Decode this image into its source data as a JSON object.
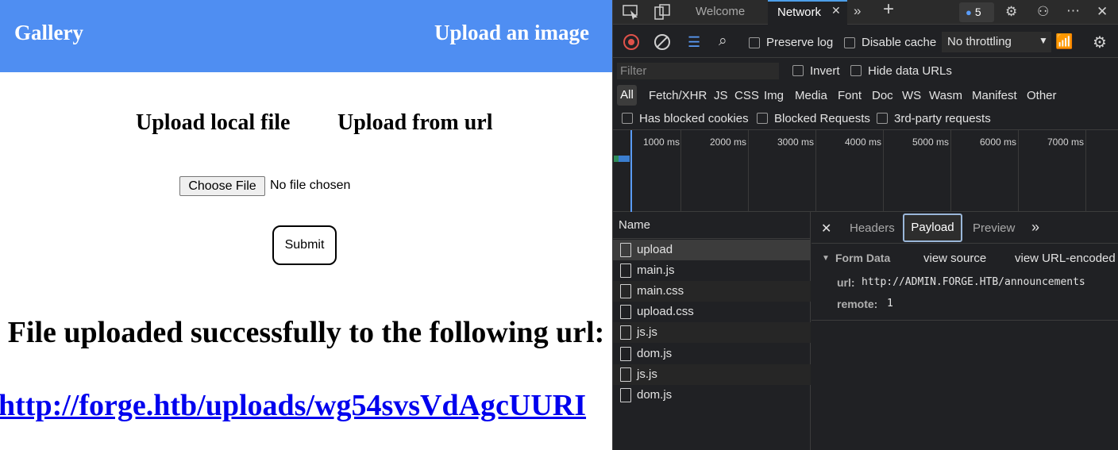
{
  "navbar": {
    "brand": "Gallery",
    "upload_link": "Upload an image"
  },
  "upload_tabs": {
    "local": "Upload local file",
    "url": "Upload from url"
  },
  "file_input": {
    "button_label": "Choose File",
    "status": "No file chosen"
  },
  "submit_label": "Submit",
  "result": {
    "message": "File uploaded successfully to the following url:",
    "url": "http://forge.htb/uploads/wg54svsVdAgcUURI"
  },
  "devtools": {
    "tabs": {
      "welcome": "Welcome",
      "network": "Network",
      "issues_count": "5"
    },
    "toolbar": {
      "preserve_log": "Preserve log",
      "disable_cache": "Disable cache",
      "throttling": "No throttling"
    },
    "filter": {
      "placeholder": "Filter",
      "invert": "Invert",
      "hide_data_urls": "Hide data URLs"
    },
    "types": [
      "All",
      "Fetch/XHR",
      "JS",
      "CSS",
      "Img",
      "Media",
      "Font",
      "Doc",
      "WS",
      "Wasm",
      "Manifest",
      "Other"
    ],
    "options": {
      "blocked_cookies": "Has blocked cookies",
      "blocked_requests": "Blocked Requests",
      "third_party": "3rd-party requests"
    },
    "timeline_ticks": [
      "1000 ms",
      "2000 ms",
      "3000 ms",
      "4000 ms",
      "5000 ms",
      "6000 ms",
      "7000 ms"
    ],
    "name_header": "Name",
    "requests": [
      "upload",
      "main.js",
      "main.css",
      "upload.css",
      "js.js",
      "dom.js",
      "js.js",
      "dom.js"
    ],
    "detail_tabs": {
      "headers": "Headers",
      "payload": "Payload",
      "preview": "Preview"
    },
    "payload": {
      "section": "Form Data",
      "view_source": "view source",
      "view_url_encoded": "view URL-encoded",
      "url_key": "url:",
      "url_value": "http://ADMIN.FORGE.HTB/announcements",
      "remote_key": "remote:",
      "remote_value": "1"
    }
  }
}
